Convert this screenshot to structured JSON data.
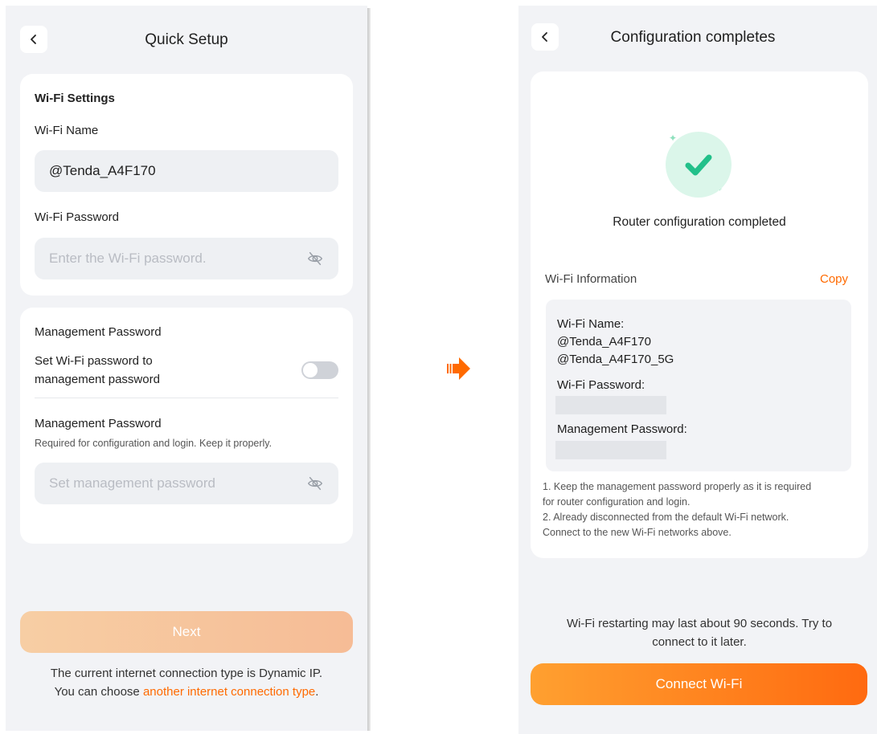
{
  "left": {
    "title": "Quick Setup",
    "wifi_section": {
      "heading": "Wi-Fi Settings",
      "name_label": "Wi-Fi Name",
      "name_value": "@Tenda_A4F170",
      "password_label": "Wi-Fi Password",
      "password_placeholder": "Enter the Wi-Fi password."
    },
    "mgmt_section": {
      "heading": "Management Password",
      "toggle_label_line1": "Set Wi-Fi password to",
      "toggle_label_line2": "management password",
      "toggle_on": false,
      "password_label": "Management Password",
      "hint": "Required for configuration and login. Keep it properly.",
      "password_placeholder": "Set management password"
    },
    "next_label": "Next",
    "footer_line1": "The current internet connection type is Dynamic IP.",
    "footer_line2_prefix": "You can choose ",
    "footer_link": "another internet connection type",
    "footer_line2_suffix": "."
  },
  "right": {
    "title": "Configuration completes",
    "status": "Router configuration completed",
    "info_label": "Wi-Fi Information",
    "copy_label": "Copy",
    "wifi_name_label": "Wi-Fi Name:",
    "wifi_name_24": "@Tenda_A4F170",
    "wifi_name_5g": "@Tenda_A4F170_5G",
    "wifi_password_label": "Wi-Fi Password:",
    "mgmt_password_label": "Management Password:",
    "note1_line1": "1. Keep the management password properly as it is required",
    "note1_line2": "for router configuration and login.",
    "note2_line1": "2. Already disconnected from the default Wi-Fi network.",
    "note2_line2": "Connect to the new Wi-Fi networks above.",
    "restart_line1": "Wi-Fi restarting may last about 90 seconds. Try to",
    "restart_line2": "connect to it later.",
    "connect_label": "Connect Wi-Fi"
  },
  "icons": {
    "back": "chevron-left-icon",
    "eye": "eye-off-icon",
    "success": "check-icon",
    "flow": "arrow-right-icon"
  },
  "colors": {
    "accent": "#ff6a00",
    "success": "#22c08a",
    "screen_bg": "#f2f3f6"
  }
}
